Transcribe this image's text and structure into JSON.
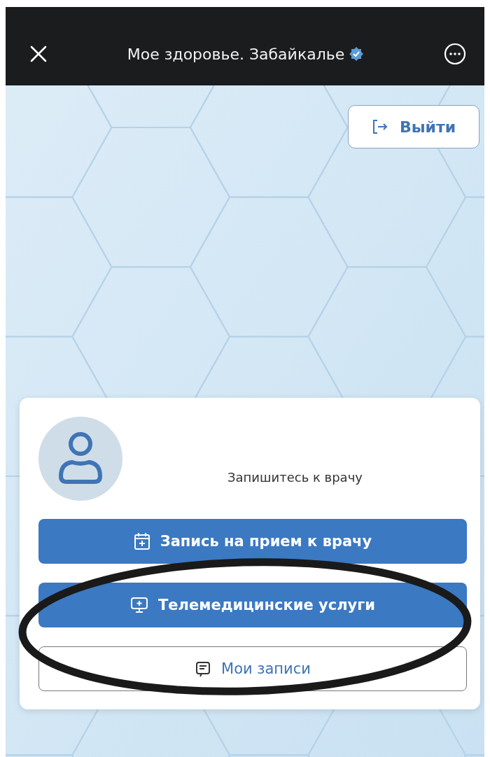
{
  "header": {
    "title": "Мое здоровье. Забайкалье",
    "verified": true
  },
  "logout_button": {
    "label": "Выйти"
  },
  "card": {
    "prompt": "Запишитесь к врачу",
    "buttons": [
      {
        "label": "Запись на прием к врачу",
        "kind": "primary"
      },
      {
        "label": "Телемедицинские услуги",
        "kind": "primary"
      },
      {
        "label": "Мои записи",
        "kind": "outline"
      }
    ]
  }
}
